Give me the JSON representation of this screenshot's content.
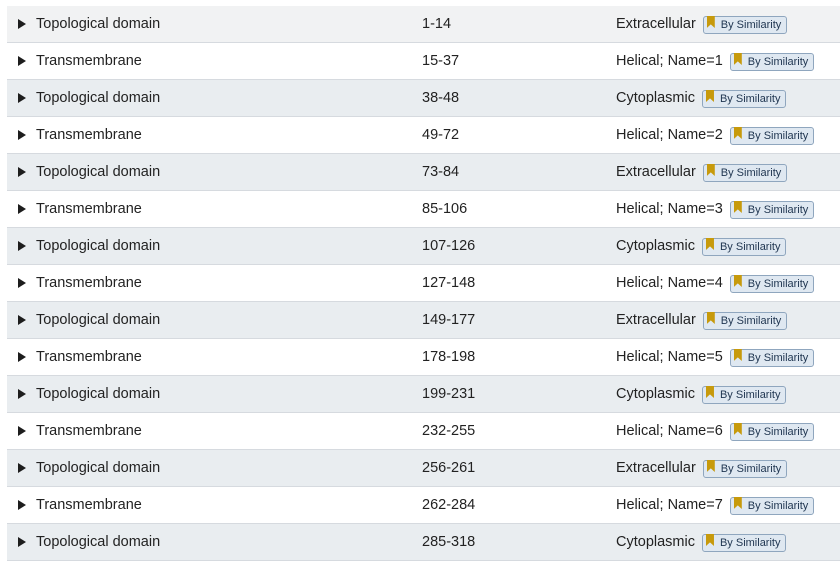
{
  "evidence_label": "By Similarity",
  "rows": [
    {
      "type": "Topological domain",
      "position": "1-14",
      "description": "Extracellular"
    },
    {
      "type": "Transmembrane",
      "position": "15-37",
      "description": "Helical; Name=1"
    },
    {
      "type": "Topological domain",
      "position": "38-48",
      "description": "Cytoplasmic"
    },
    {
      "type": "Transmembrane",
      "position": "49-72",
      "description": "Helical; Name=2"
    },
    {
      "type": "Topological domain",
      "position": "73-84",
      "description": "Extracellular"
    },
    {
      "type": "Transmembrane",
      "position": "85-106",
      "description": "Helical; Name=3"
    },
    {
      "type": "Topological domain",
      "position": "107-126",
      "description": "Cytoplasmic"
    },
    {
      "type": "Transmembrane",
      "position": "127-148",
      "description": "Helical; Name=4"
    },
    {
      "type": "Topological domain",
      "position": "149-177",
      "description": "Extracellular"
    },
    {
      "type": "Transmembrane",
      "position": "178-198",
      "description": "Helical; Name=5"
    },
    {
      "type": "Topological domain",
      "position": "199-231",
      "description": "Cytoplasmic"
    },
    {
      "type": "Transmembrane",
      "position": "232-255",
      "description": "Helical; Name=6"
    },
    {
      "type": "Topological domain",
      "position": "256-261",
      "description": "Extracellular"
    },
    {
      "type": "Transmembrane",
      "position": "262-284",
      "description": "Helical; Name=7"
    },
    {
      "type": "Topological domain",
      "position": "285-318",
      "description": "Cytoplasmic"
    }
  ],
  "colors": {
    "shaded_row": "#e9edf0",
    "badge_bg": "#dfe8f1",
    "badge_border": "#8fa6be",
    "bookmark": "#c79a0c"
  },
  "icons": {
    "expand": "triangle-right-icon",
    "evidence": "bookmark-icon"
  }
}
